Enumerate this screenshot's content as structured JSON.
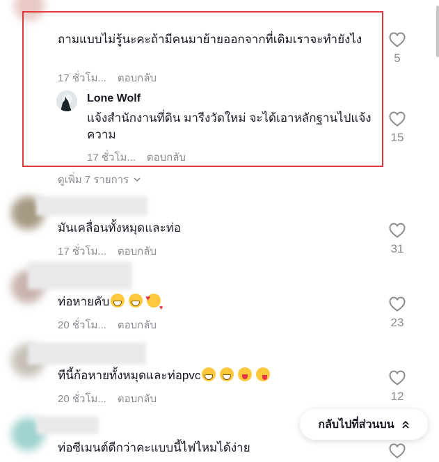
{
  "comments": [
    {
      "text": "ถามแบบไม่รู้นะคะถ้ามีคนมาย้ายออกจากที่เดิมเราจะทำยังไง",
      "time": "17 ชั่วโม...",
      "reply": "ตอบกลับ",
      "likes": "5",
      "replies": [
        {
          "author": "Lone Wolf",
          "text": "แจ้งสำนักงานที่ดิน มารีงวัดใหม่ จะได้เอาหลักฐานไปแจ้งความ",
          "time": "17 ชั่วโม...",
          "reply": "ตอบกลับ",
          "likes": "15"
        }
      ],
      "view_more": "ดูเพิ่ม 7 รายการ"
    },
    {
      "text": "มันเคลื่อนทั้งหมุดและท่อ",
      "time": "17 ชั่วโม...",
      "reply": "ตอบกลับ",
      "likes": "31"
    },
    {
      "text": "ท่อหายคับ",
      "emojis": [
        "grin-icon",
        "grin-icon",
        "smiling-face-with-hearts-icon"
      ],
      "time": "20 ชั่วโม...",
      "reply": "ตอบกลับ",
      "likes": "23"
    },
    {
      "text": "ทีนี้ก้อหายทั้งหมุดและท่อpvc",
      "emojis": [
        "grin-icon",
        "grin-icon",
        "zany-face-icon",
        "winking-tongue-icon"
      ],
      "time": "20 ชั่วโม...",
      "reply": "ตอบกลับ",
      "likes": "12"
    },
    {
      "text": "ท่อซีเมนต์ดีกว่าคะแบบนี้ไฟไหมได้ง่าย",
      "likes": ""
    }
  ],
  "back_to_top": "กลับไปที่ส่วนบน",
  "colors": {
    "highlight": "#e0393e",
    "meta": "#8a8b91",
    "text": "#161823"
  }
}
